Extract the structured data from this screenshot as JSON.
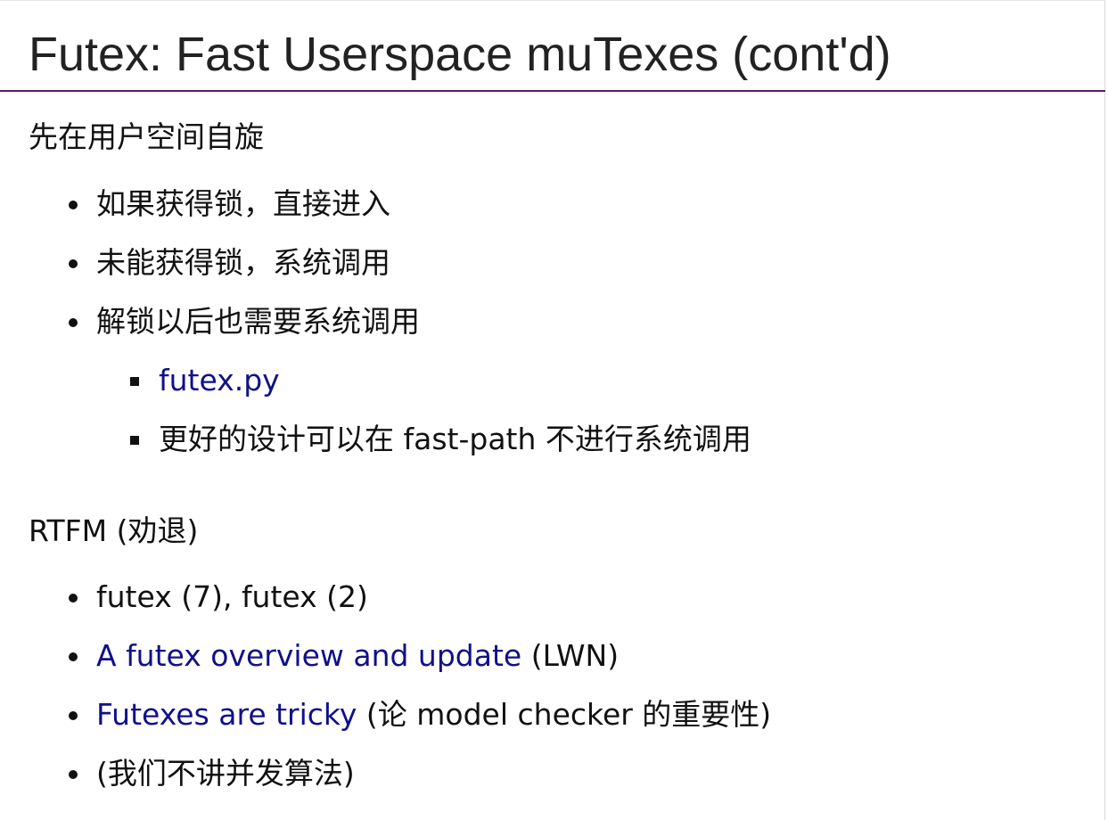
{
  "slide": {
    "title": "Futex: Fast Userspace muTexes (cont'd)",
    "section1": {
      "heading": "先在用户空间自旋",
      "items": [
        "如果获得锁，直接进入",
        "未能获得锁，系统调用",
        "解锁以后也需要系统调用"
      ],
      "subitems": [
        {
          "link": "futex.py"
        },
        {
          "text": "更好的设计可以在 fast-path 不进行系统调用"
        }
      ]
    },
    "section2": {
      "heading": "RTFM (劝退)",
      "items": [
        {
          "text": "futex (7), futex (2)"
        },
        {
          "link": "A futex overview and update",
          "suffix": " (LWN)"
        },
        {
          "link": "Futexes are tricky",
          "suffix": " (论 model checker 的重要性)"
        },
        {
          "text": "(我们不讲并发算法)"
        }
      ]
    }
  },
  "colors": {
    "link": "#10108a",
    "rule": "#5a1a6a",
    "text": "#111111"
  }
}
